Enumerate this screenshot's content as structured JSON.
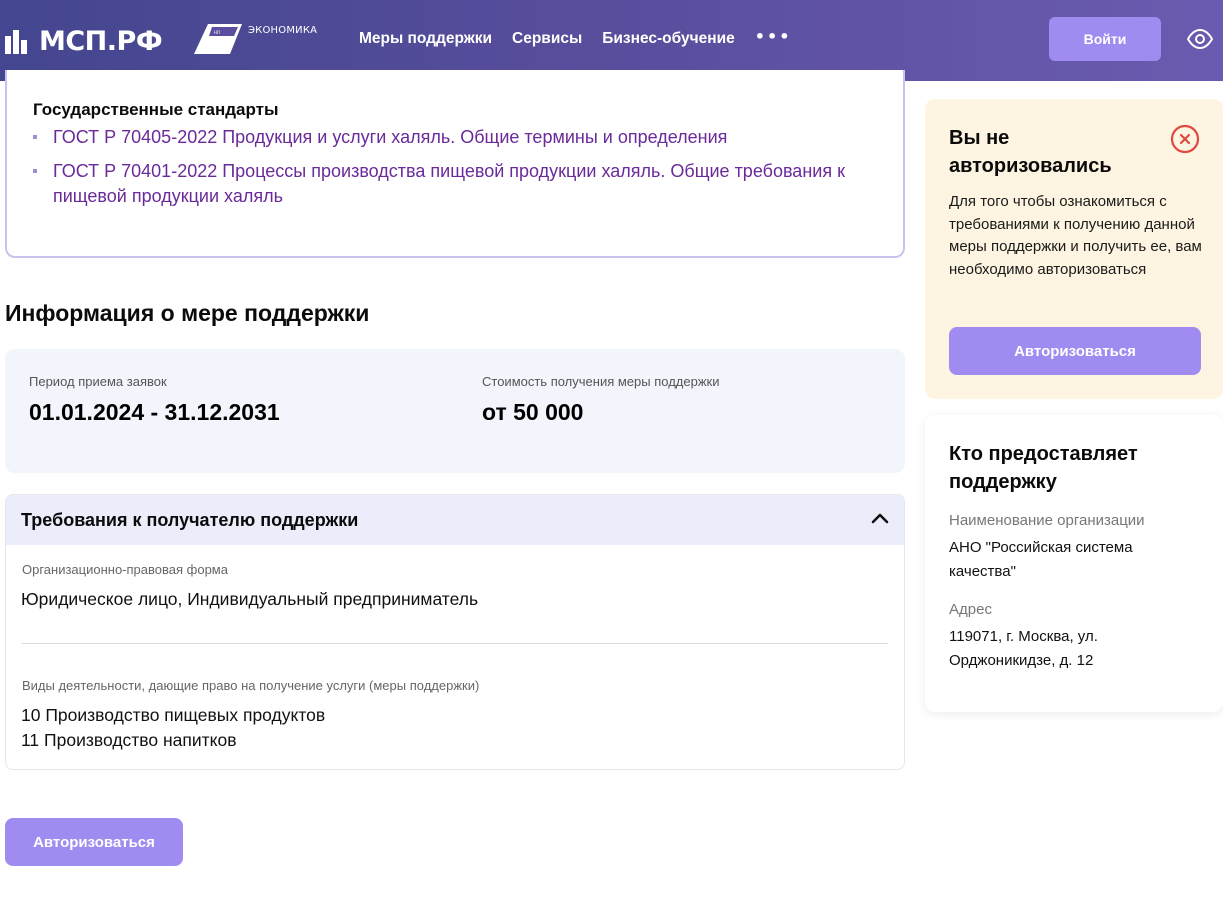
{
  "header": {
    "logo_text": "МСП.РФ",
    "np_label": "ЭКОНОМИКА",
    "nav": [
      "Меры поддержки",
      "Сервисы",
      "Бизнес-обучение"
    ],
    "more": "•••",
    "login_label": "Войти"
  },
  "standards": {
    "title": "Государственные стандарты",
    "items": [
      "ГОСТ Р 70405-2022 Продукция и услуги халяль. Общие термины и определения",
      "ГОСТ Р 70401-2022 Процессы производства пищевой продукции халяль. Общие требования к пищевой продукции халяль"
    ]
  },
  "info": {
    "heading": "Информация о мере поддержки",
    "period_label": "Период приема заявок",
    "period_value": "01.01.2024 - 31.12.2031",
    "cost_label": "Стоимость получения меры поддержки",
    "cost_value": "от 50 000"
  },
  "requirements": {
    "title": "Требования к получателю поддержки",
    "form_label": "Организационно-правовая форма",
    "form_value": "Юридическое лицо, Индивидуальный предприниматель",
    "activity_label": "Виды деятельности, дающие право на получение услуги (меры поддержки)",
    "activities": [
      "10 Производство пищевых продуктов",
      "11 Производство напитков"
    ]
  },
  "auth_button": "Авторизоваться",
  "notice": {
    "title": "Вы не авторизовались",
    "text": "Для того чтобы ознакомиться с требованиями к получению данной меры поддержки и получить ее, вам необходимо авторизоваться",
    "button": "Авторизоваться"
  },
  "provider": {
    "title": "Кто предоставляет поддержку",
    "org_label": "Наименование организации",
    "org_value": "АНО \"Российская система качества\"",
    "addr_label": "Адрес",
    "addr_value": "119071, г. Москва, ул. Орджоникидзе, д. 12"
  },
  "colors": {
    "accent": "#a08cf0",
    "header_from": "#44468f",
    "header_to": "#6b5bb0",
    "link": "#6a2a9a",
    "notice_bg": "#fdf5e1",
    "close_red": "#e0493f"
  }
}
